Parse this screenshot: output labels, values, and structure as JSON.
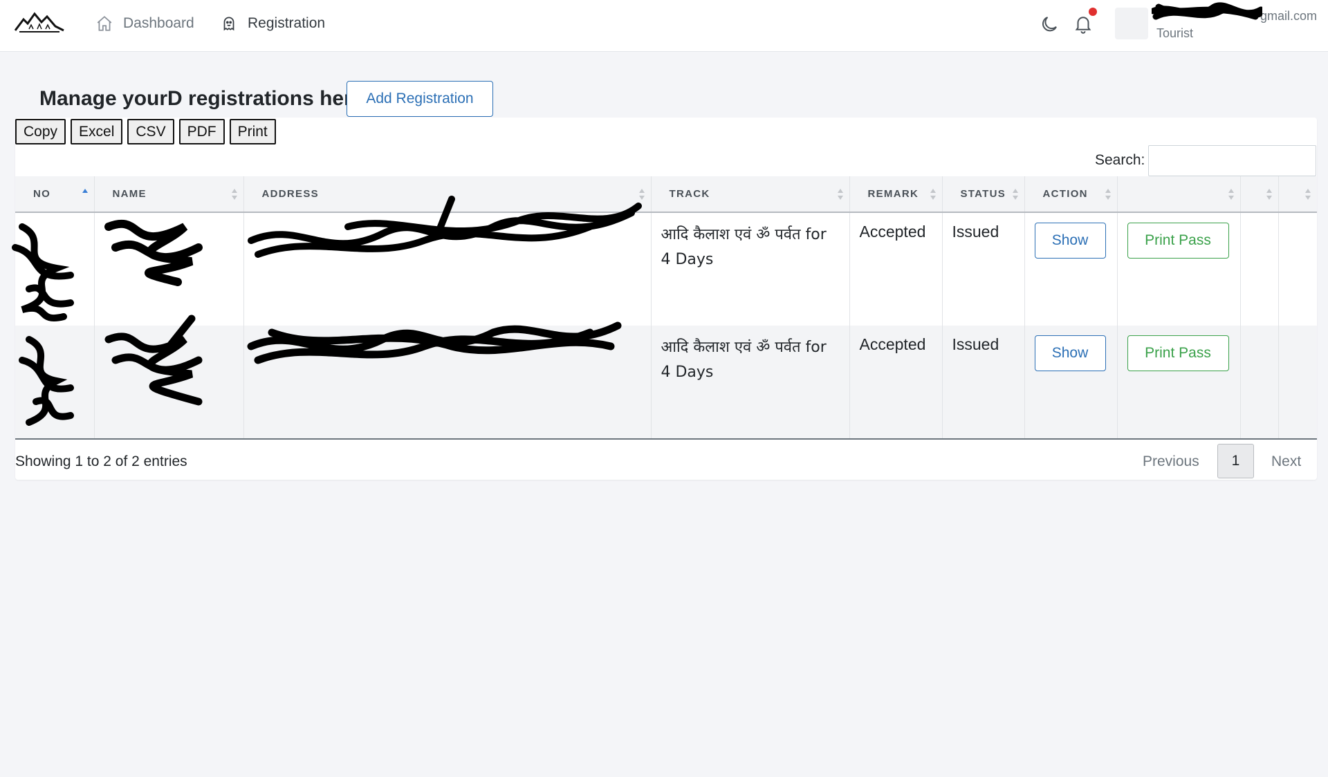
{
  "nav": {
    "dashboard": "Dashboard",
    "registration": "Registration",
    "user_email": "gmail.com",
    "user_role": "Tourist"
  },
  "page": {
    "title": "Manage yourD registrations here",
    "add_button": "Add Registration"
  },
  "export_buttons": [
    "Copy",
    "Excel",
    "CSV",
    "PDF",
    "Print"
  ],
  "search": {
    "label": "Search:",
    "value": ""
  },
  "table": {
    "columns": [
      "NO",
      "NAME",
      "ADDRESS",
      "TRACK",
      "REMARK",
      "STATUS",
      "ACTION",
      "",
      "",
      ""
    ],
    "rows": [
      {
        "track": "आदि कैलाश एवं ॐ पर्वत for 4 Days",
        "remark": "Accepted",
        "status": "Issued",
        "show": "Show",
        "print": "Print Pass"
      },
      {
        "track": "आदि कैलाश एवं ॐ पर्वत for 4 Days",
        "remark": "Accepted",
        "status": "Issued",
        "show": "Show",
        "print": "Print Pass"
      }
    ]
  },
  "footer": {
    "info": "Showing 1 to 2 of 2 entries",
    "previous": "Previous",
    "current_page": "1",
    "next": "Next"
  },
  "colors": {
    "primary": "#2b6fb5",
    "success": "#3aa14a",
    "notification": "#e0302f",
    "background": "#f4f5f8"
  }
}
